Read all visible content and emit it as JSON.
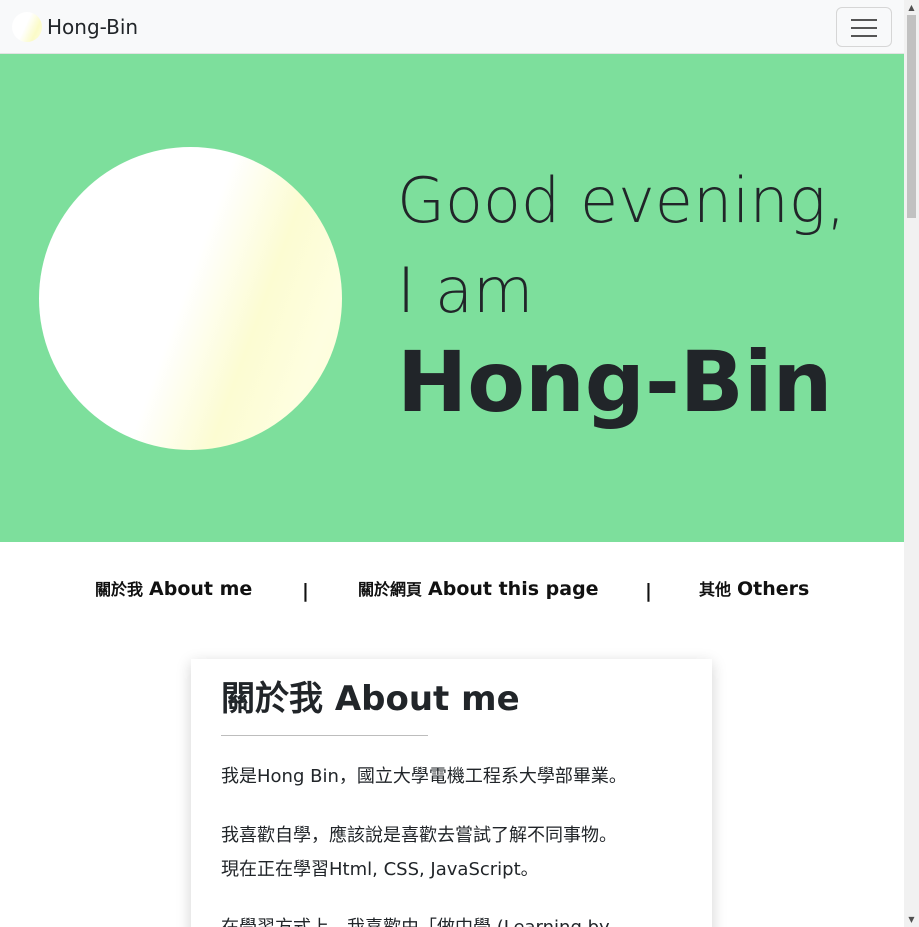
{
  "navbar": {
    "brand_name": "Hong-Bin",
    "logo_icon": "sun-logo-icon",
    "menu_icon": "hamburger-menu-icon"
  },
  "hero": {
    "greeting": "Good evening,",
    "intro": "I am",
    "name": "Hong-Bin",
    "background_color": "#7ddf9c",
    "avatar_icon": "gradient-circle-avatar"
  },
  "section_nav": {
    "items": [
      {
        "zh": "關於我",
        "en": "About me"
      },
      {
        "zh": "關於網頁",
        "en": "About this page"
      },
      {
        "zh": "其他",
        "en": "Others"
      }
    ],
    "separator": "|"
  },
  "about_card": {
    "title": "關於我 About me",
    "paragraphs": [
      "我是Hong Bin，國立大學電機工程系大學部畢業。",
      "我喜歡自學，應該說是喜歡去嘗試了解不同事物。",
      "現在正在學習Html, CSS, JavaScript。",
      "在學習方式上，我喜歡由「做中學 (Learning by"
    ]
  },
  "scrollbar": {
    "up_icon": "scroll-up-arrow-icon",
    "down_icon": "scroll-down-arrow-icon"
  }
}
